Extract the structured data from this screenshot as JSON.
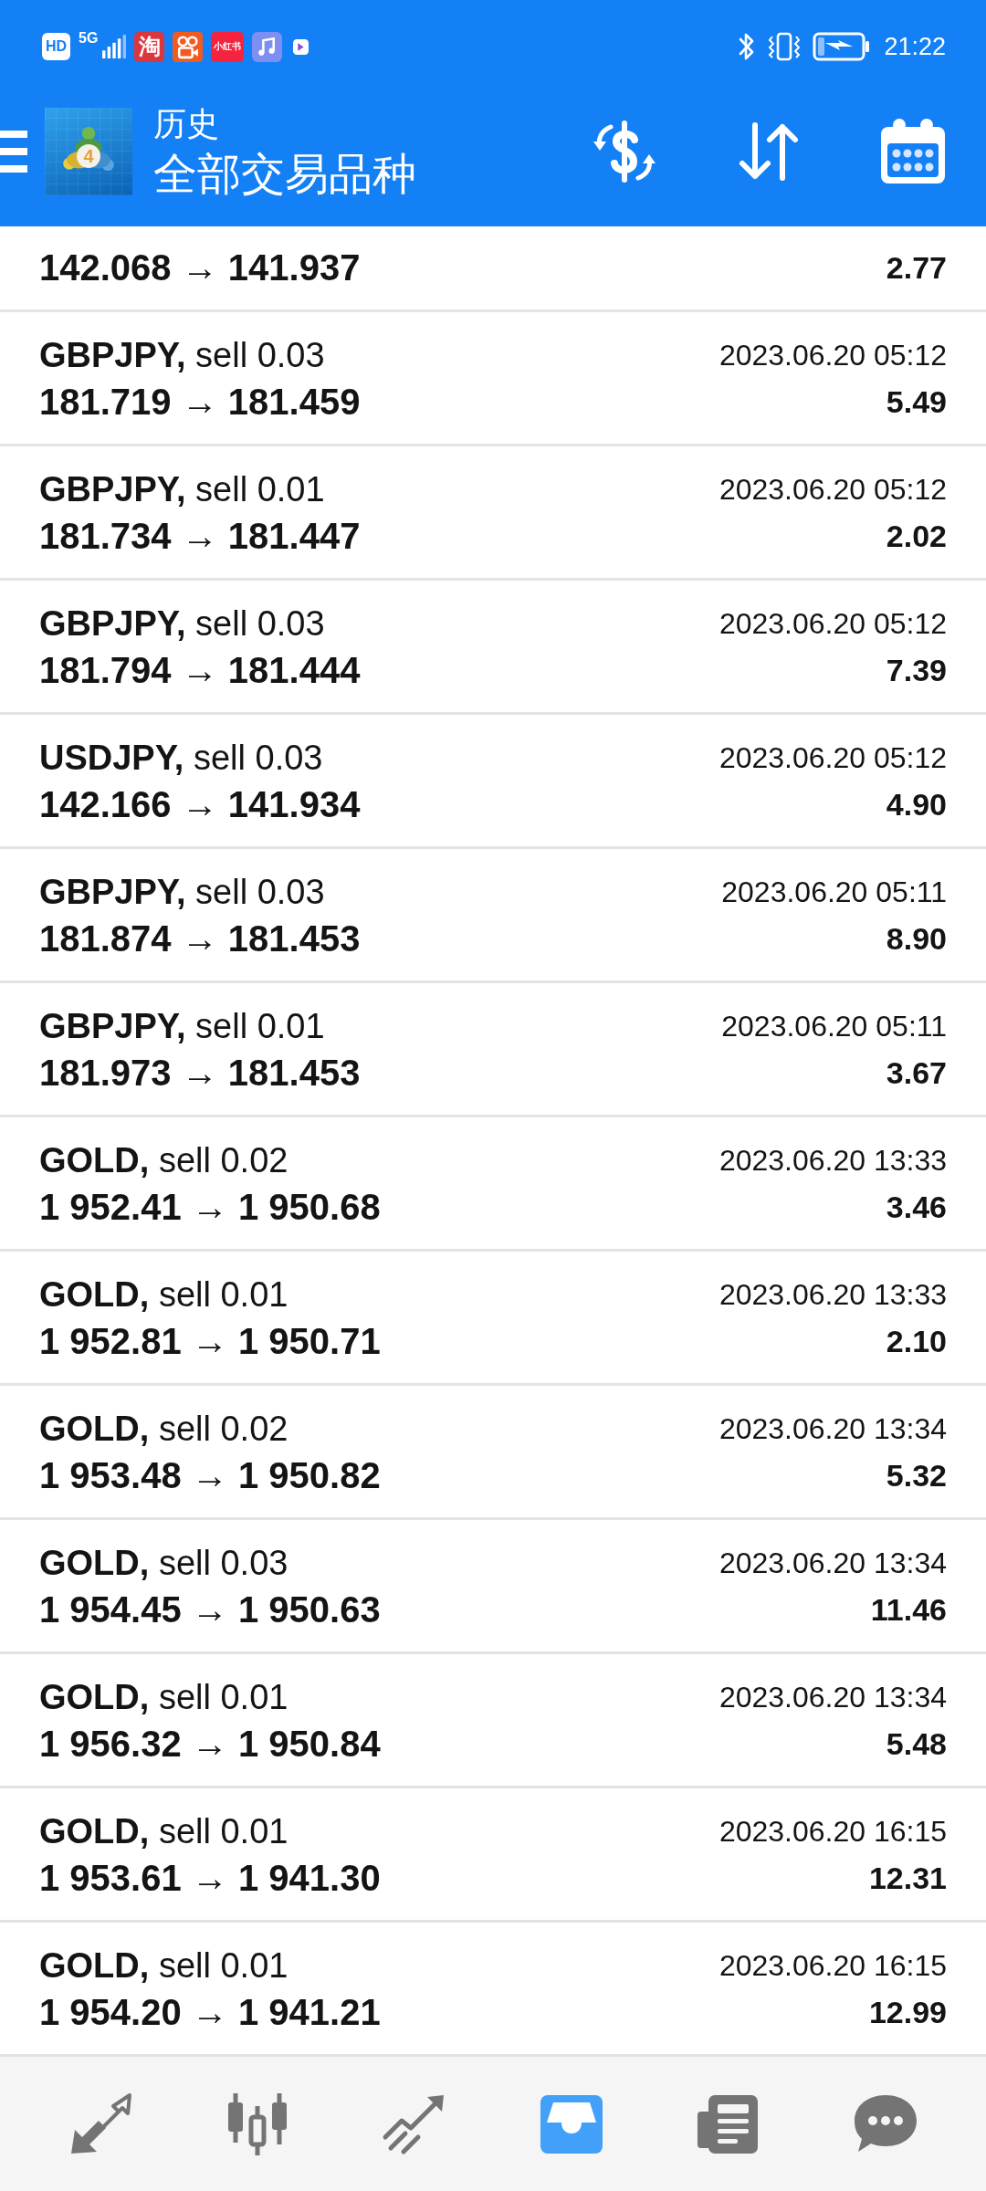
{
  "status_bar": {
    "notifications": [
      {
        "kind": "hd",
        "label": "HD"
      },
      {
        "kind": "signal",
        "label": "5G"
      },
      {
        "kind": "app",
        "label": "淘",
        "color": "#d9363e"
      },
      {
        "kind": "camera",
        "color": "#f25a1f"
      },
      {
        "kind": "app",
        "label": "小红书",
        "color": "#f5233f"
      },
      {
        "kind": "music",
        "color": "#7d8ff2"
      },
      {
        "kind": "dot"
      }
    ],
    "time": "21:22"
  },
  "header": {
    "title": "历史",
    "subtitle": "全部交易品种",
    "logo_badge": "4"
  },
  "trades": [
    {
      "prices": "142.068 → 141.937",
      "profit": "2.77"
    },
    {
      "title": "**GBPJPY,** sell 0.03",
      "time": "2023.06.20 05:12",
      "prices": "181.719 → 181.459",
      "profit": "5.49"
    },
    {
      "title": "**GBPJPY,** sell 0.01",
      "time": "2023.06.20 05:12",
      "prices": "181.734 → 181.447",
      "profit": "2.02"
    },
    {
      "title": "**GBPJPY,** sell 0.03",
      "time": "2023.06.20 05:12",
      "prices": "181.794 → 181.444",
      "profit": "7.39"
    },
    {
      "title": "**USDJPY,** sell 0.03",
      "time": "2023.06.20 05:12",
      "prices": "142.166 → 141.934",
      "profit": "4.90"
    },
    {
      "title": "**GBPJPY,** sell 0.03",
      "time": "2023.06.20 05:11",
      "prices": "181.874 → 181.453",
      "profit": "8.90"
    },
    {
      "title": "**GBPJPY,** sell 0.01",
      "time": "2023.06.20 05:11",
      "prices": "181.973 → 181.453",
      "profit": "3.67"
    },
    {
      "title": "**GOLD,** sell 0.02",
      "time": "2023.06.20 13:33",
      "prices": "1 952.41 → 1 950.68",
      "profit": "3.46"
    },
    {
      "title": "**GOLD,** sell 0.01",
      "time": "2023.06.20 13:33",
      "prices": "1 952.81 → 1 950.71",
      "profit": "2.10"
    },
    {
      "title": "**GOLD,** sell 0.02",
      "time": "2023.06.20 13:34",
      "prices": "1 953.48 → 1 950.82",
      "profit": "5.32"
    },
    {
      "title": "**GOLD,** sell 0.03",
      "time": "2023.06.20 13:34",
      "prices": "1 954.45 → 1 950.63",
      "profit": "11.46"
    },
    {
      "title": "**GOLD,** sell 0.01",
      "time": "2023.06.20 13:34",
      "prices": "1 956.32 → 1 950.84",
      "profit": "5.48"
    },
    {
      "title": "**GOLD,** sell 0.01",
      "time": "2023.06.20 16:15",
      "prices": "1 953.61 → 1 941.30",
      "profit": "12.31"
    },
    {
      "title": "**GOLD,** sell 0.01",
      "time": "2023.06.20 16:15",
      "prices": "1 954.20 → 1 941.21",
      "profit": "12.99"
    }
  ],
  "nav": [
    {
      "kind": "trade",
      "selected": false
    },
    {
      "kind": "quotes",
      "selected": false
    },
    {
      "kind": "chart",
      "selected": false
    },
    {
      "kind": "history",
      "selected": true
    },
    {
      "kind": "news",
      "selected": false
    },
    {
      "kind": "chat",
      "selected": false
    }
  ]
}
